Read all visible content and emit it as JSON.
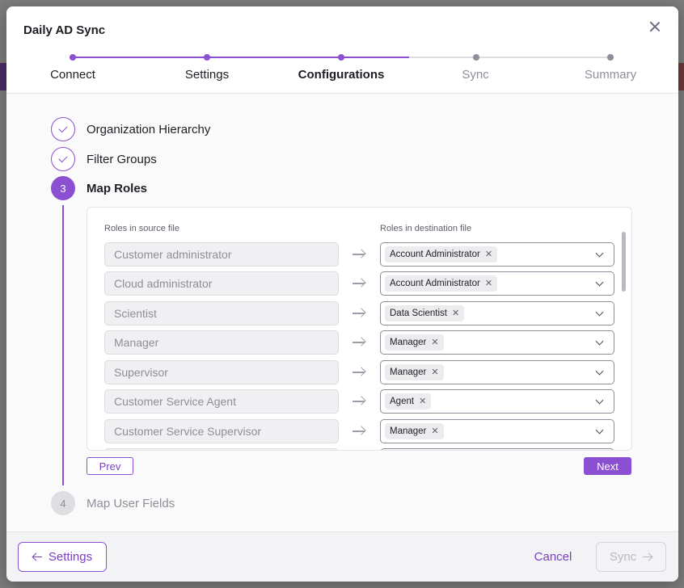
{
  "modal": {
    "title": "Daily AD Sync"
  },
  "stepper": {
    "steps": [
      {
        "label": "Connect",
        "state": "done"
      },
      {
        "label": "Settings",
        "state": "done"
      },
      {
        "label": "Configurations",
        "state": "current"
      },
      {
        "label": "Sync",
        "state": "future"
      },
      {
        "label": "Summary",
        "state": "future"
      }
    ],
    "colors": {
      "done": "#8b4fd1",
      "future": "#dedee2"
    }
  },
  "config_steps": [
    {
      "number": "1",
      "label": "Organization Hierarchy",
      "state": "done"
    },
    {
      "number": "2",
      "label": "Filter Groups",
      "state": "done"
    },
    {
      "number": "3",
      "label": "Map Roles",
      "state": "active"
    },
    {
      "number": "4",
      "label": "Map User Fields",
      "state": "pending"
    }
  ],
  "map_roles": {
    "source_header": "Roles in source file",
    "destination_header": "Roles in destination file",
    "rows": [
      {
        "source": "Customer administrator",
        "destination": "Account Administrator"
      },
      {
        "source": "Cloud administrator",
        "destination": "Account Administrator"
      },
      {
        "source": "Scientist",
        "destination": "Data Scientist"
      },
      {
        "source": "Manager",
        "destination": "Manager"
      },
      {
        "source": "Supervisor",
        "destination": "Manager"
      },
      {
        "source": "Customer Service Agent",
        "destination": "Agent"
      },
      {
        "source": "Customer Service Supervisor",
        "destination": "Manager"
      }
    ],
    "prev_label": "Prev",
    "next_label": "Next"
  },
  "footer": {
    "back_label": "Settings",
    "cancel_label": "Cancel",
    "sync_label": "Sync"
  },
  "icons": {
    "close": "close-icon",
    "check": "check-icon",
    "arrow_right": "arrow-right-icon",
    "arrow_left": "arrow-left-icon",
    "chevron": "chevron-down-icon",
    "remove": "remove-icon"
  },
  "colors": {
    "accent": "#8b4fd1",
    "text": "#1e1e24",
    "muted": "#8e8e99"
  }
}
